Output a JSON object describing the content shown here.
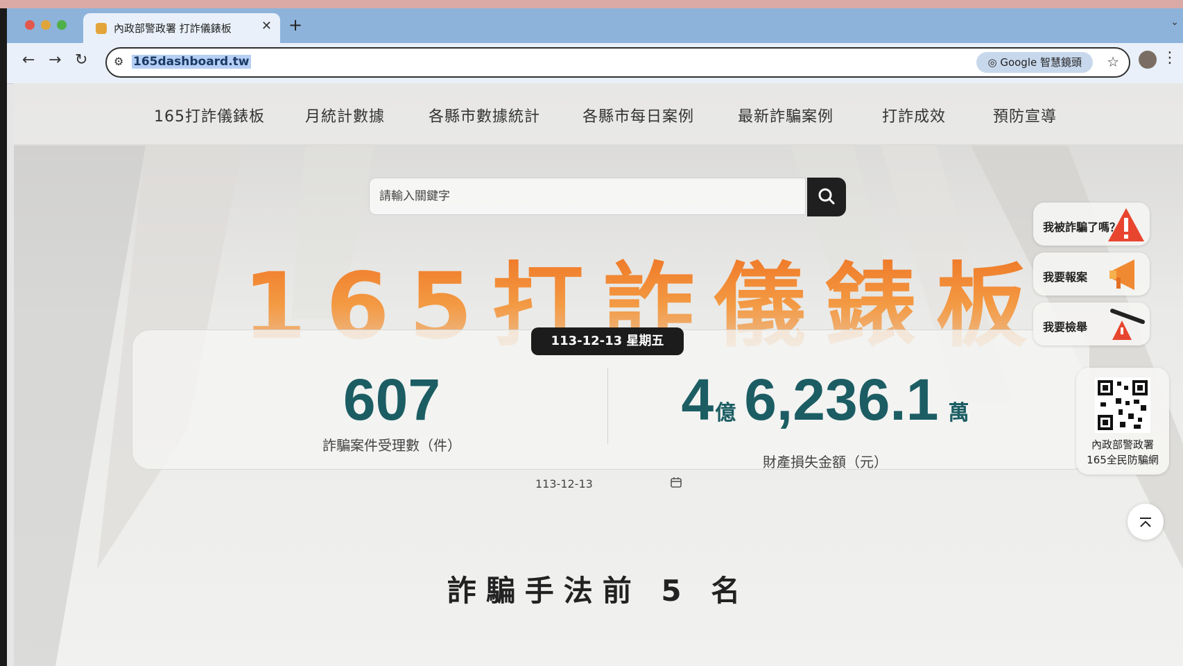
{
  "browser": {
    "tab_title": "內政部警政署 打詐儀錶板",
    "tab_close": "✕",
    "new_tab": "+",
    "url": "165dashboard.tw",
    "lens_label": "Google 智慧鏡頭",
    "icons": [
      "back-icon",
      "forward-icon",
      "reload-icon",
      "site-info-icon",
      "lens-icon",
      "bookmark-star-icon",
      "profile-avatar",
      "more-menu-icon"
    ]
  },
  "site_nav": {
    "items": [
      {
        "label": "165打詐儀錶板"
      },
      {
        "label": "月統計數據"
      },
      {
        "label": "各縣市數據統計"
      },
      {
        "label": "各縣市每日案例"
      },
      {
        "label": "最新詐騙案例"
      },
      {
        "label": "打詐成效"
      },
      {
        "label": "預防宣導"
      }
    ]
  },
  "search": {
    "placeholder": "請輸入關鍵字"
  },
  "hero": {
    "title": "165打詐儀錶板",
    "date_badge": "113-12-13 星期五"
  },
  "stats": {
    "cases": {
      "value": "607",
      "label": "詐騙案件受理數（件）"
    },
    "loss": {
      "yi": "4",
      "yi_unit": "億",
      "wan": "6,236.1",
      "wan_unit": "萬",
      "label": "財產損失金額（元）"
    }
  },
  "date_picker": {
    "value": "113-12-13"
  },
  "side_actions": [
    {
      "label": "我被詐騙了嗎？",
      "icon": "warning-icon"
    },
    {
      "label": "我要報案",
      "icon": "megaphone-icon"
    },
    {
      "label": "我要檢舉",
      "icon": "alarm-icon"
    }
  ],
  "qr": {
    "caption_line1": "內政部警政署",
    "caption_line2": "165全民防騙網"
  },
  "section": {
    "heading": "詐騙手法前 5 名"
  },
  "colors": {
    "accent_orange": "#ef8125",
    "stat_teal": "#1b5d63",
    "badge_dark": "#1c1c1c"
  }
}
